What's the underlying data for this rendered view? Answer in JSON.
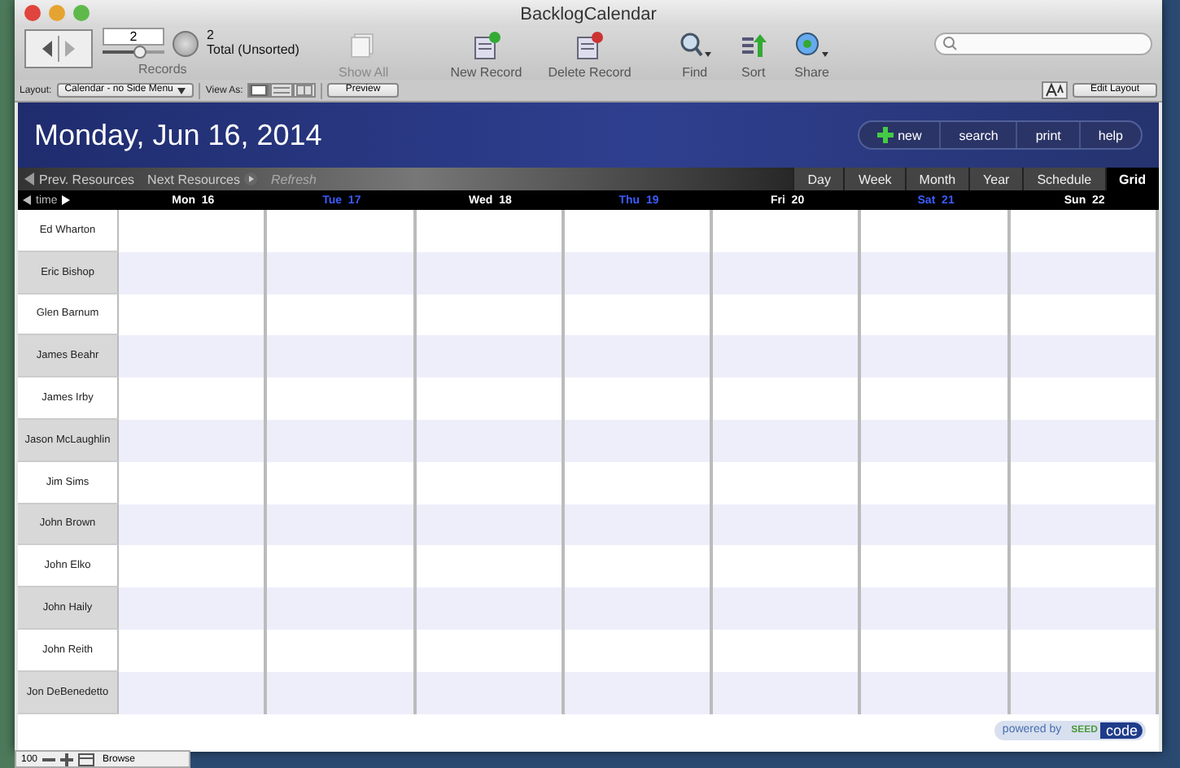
{
  "window": {
    "title": "BacklogCalendar"
  },
  "toolbar": {
    "record_number": "2",
    "record_count": "2",
    "record_status": "Total (Unsorted)",
    "records_label": "Records",
    "slider": {
      "level": 0.6
    },
    "buttons": [
      {
        "kind": "showall",
        "label": "Show All",
        "disabled": true
      },
      {
        "kind": "new",
        "label": "New Record",
        "disabled": false
      },
      {
        "kind": "delete",
        "label": "Delete Record",
        "disabled": false
      },
      {
        "kind": "find",
        "label": "Find",
        "disabled": false
      },
      {
        "kind": "sort",
        "label": "Sort",
        "disabled": false
      },
      {
        "kind": "share",
        "label": "Share",
        "disabled": false
      }
    ]
  },
  "layout_bar": {
    "layout_label": "Layout:",
    "layout_value": "Calendar - no Side Menu",
    "view_label": "View As:",
    "views": [
      {
        "kind": "form",
        "selected": true
      },
      {
        "kind": "list",
        "selected": false
      },
      {
        "kind": "table",
        "selected": false
      }
    ],
    "preview": "Preview",
    "edit_layout": "Edit Layout"
  },
  "header": {
    "date": "Monday, Jun 16, 2014",
    "actions": [
      {
        "label": "new",
        "kind": "add"
      },
      {
        "label": "search",
        "kind": "plain"
      },
      {
        "label": "print",
        "kind": "plain"
      },
      {
        "label": "help",
        "kind": "plain"
      }
    ]
  },
  "nav": [
    {
      "label": "Prev. Resources",
      "kind": "prev",
      "disabled": false
    },
    {
      "label": "Next Resources",
      "kind": "next",
      "disabled": false
    },
    {
      "label": "Refresh",
      "kind": "plain",
      "disabled": true
    }
  ],
  "tabs": [
    {
      "label": "Day",
      "selected": false
    },
    {
      "label": "Week",
      "selected": false
    },
    {
      "label": "Month",
      "selected": false
    },
    {
      "label": "Year",
      "selected": false
    },
    {
      "label": "Schedule",
      "selected": false
    },
    {
      "label": "Grid",
      "selected": true
    }
  ],
  "time_label": "time",
  "days": [
    {
      "label": "Mon  16",
      "color": "#ffffff"
    },
    {
      "label": "Tue  17",
      "color": "#3a5cff"
    },
    {
      "label": "Wed  18",
      "color": "#ffffff"
    },
    {
      "label": "Thu  19",
      "color": "#3a5cff"
    },
    {
      "label": "Fri  20",
      "color": "#ffffff"
    },
    {
      "label": "Sat  21",
      "color": "#3a5cff"
    },
    {
      "label": "Sun  22",
      "color": "#ffffff"
    }
  ],
  "resources": [
    "Ed Wharton",
    "Eric Bishop",
    "Glen Barnum",
    "James Beahr",
    "James Irby",
    "Jason McLaughlin",
    "Jim Sims",
    "John Brown",
    "John Elko",
    "John Haily",
    "John Reith",
    "Jon DeBenedetto"
  ],
  "badge": {
    "prefix": "powered by",
    "brand_a": "SEED",
    "brand_b": "code"
  },
  "status_bar": {
    "zoom": "100",
    "mode": "Browse"
  }
}
